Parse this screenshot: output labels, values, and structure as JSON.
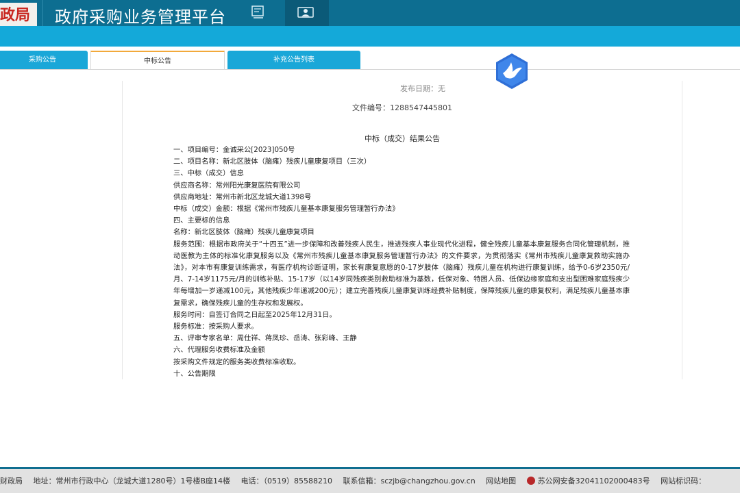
{
  "header": {
    "logo_text": "政局",
    "platform_title": "政府采购业务管理平台"
  },
  "tabs": [
    {
      "label": "采购公告"
    },
    {
      "label": "中标公告"
    },
    {
      "label": "补充公告列表"
    }
  ],
  "document": {
    "publish_date": "发布日期：无",
    "file_no_label": "文件编号：",
    "file_no": "1288547445801",
    "title": "中标（成交）结果公告",
    "body": "一、项目编号：金诚采公[2023]050号\n二、项目名称：新北区肢体（脑瘫）残疾儿童康复项目（三次）\n三、中标（成交）信息\n供应商名称：常州阳光康复医院有限公司\n供应商地址：常州市新北区龙城大道1398号\n中标（成交）金额：根据《常州市残疾儿童基本康复服务管理暂行办法》\n四、主要标的信息\n名称：新北区肢体（脑瘫）残疾儿童康复项目\n服务范围：根据市政府关于“十四五”进一步保障和改善残疾人民生，推进残疾人事业现代化进程，健全残疾儿童基本康复服务合同化管理机制，推动医教为主体的标准化康复服务以及《常州市残疾儿童基本康复服务管理暂行办法》的文件要求，为贯彻落实《常州市残疾儿童康复救助实施办法》，对本市有康复训练需求，有医疗机构诊断证明，家长有康复意愿的0-17岁肢体（脑瘫）残疾儿童在机构进行康复训练，给予0-6岁2350元/月、7-14岁1175元/月的训练补贴、15-17岁（以14岁同残疾类别救助标准为基数，低保对象、特困人员、低保边缘家庭和支出型困难家庭残疾少年每增加一岁递减100元，其他残疾少年递减200元）；建立完善残疾儿童康复训练经费补贴制度，保障残疾儿童的康复权利，满足残疾儿童基本康复需求，确保残疾儿童的生存权和发展权。\n服务时间：自签订合同之日起至2025年12月31日。\n服务标准：按采购人要求。\n五、评审专家名单：周仕祥、蒋凤珍、岳涛、张彩峰、王静\n六、代理服务收费标准及金额\n按采购文件规定的服务类收费标准收取。\n十、公告期限"
  },
  "footer": {
    "org": "财政局",
    "address": "地址：常州市行政中心（龙城大道1280号）1号楼B座14楼",
    "phone": "电话：（0519）85588210",
    "email": "联系信箱：sczjb@changzhou.gov.cn",
    "sitemap": "网站地图",
    "police_record": "苏公网安备32041102000483号",
    "site_id": "网站标识码："
  }
}
